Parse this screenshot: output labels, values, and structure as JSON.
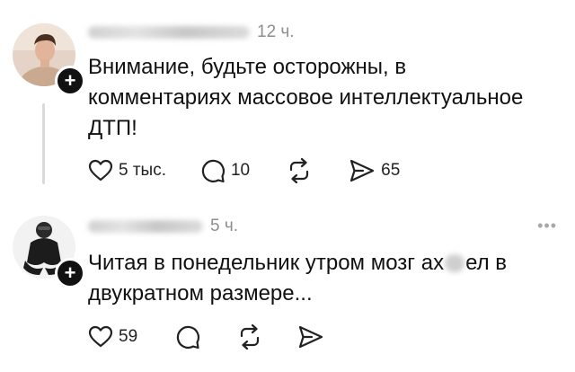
{
  "posts": [
    {
      "time": "12 ч.",
      "text": "Внимание, будьте осторожны, в комментариях массовое интеллектуальное ДТП!",
      "likes": "5 тыс.",
      "replies": "10",
      "shares": "65"
    },
    {
      "time": "5 ч.",
      "text_before": "Читая в понедельник утром мозг ах",
      "text_after": "ел в двукратном размере...",
      "likes": "59",
      "more": "•••"
    }
  ],
  "icons": {
    "follow": "+",
    "like": "heart-icon",
    "reply": "speech-bubble-icon",
    "repost": "repost-icon",
    "share": "paper-plane-icon",
    "more": "more-dots-icon"
  },
  "colors": {
    "text": "#111111",
    "muted": "#8e8e8e",
    "thread_line": "#d9d9d9"
  }
}
